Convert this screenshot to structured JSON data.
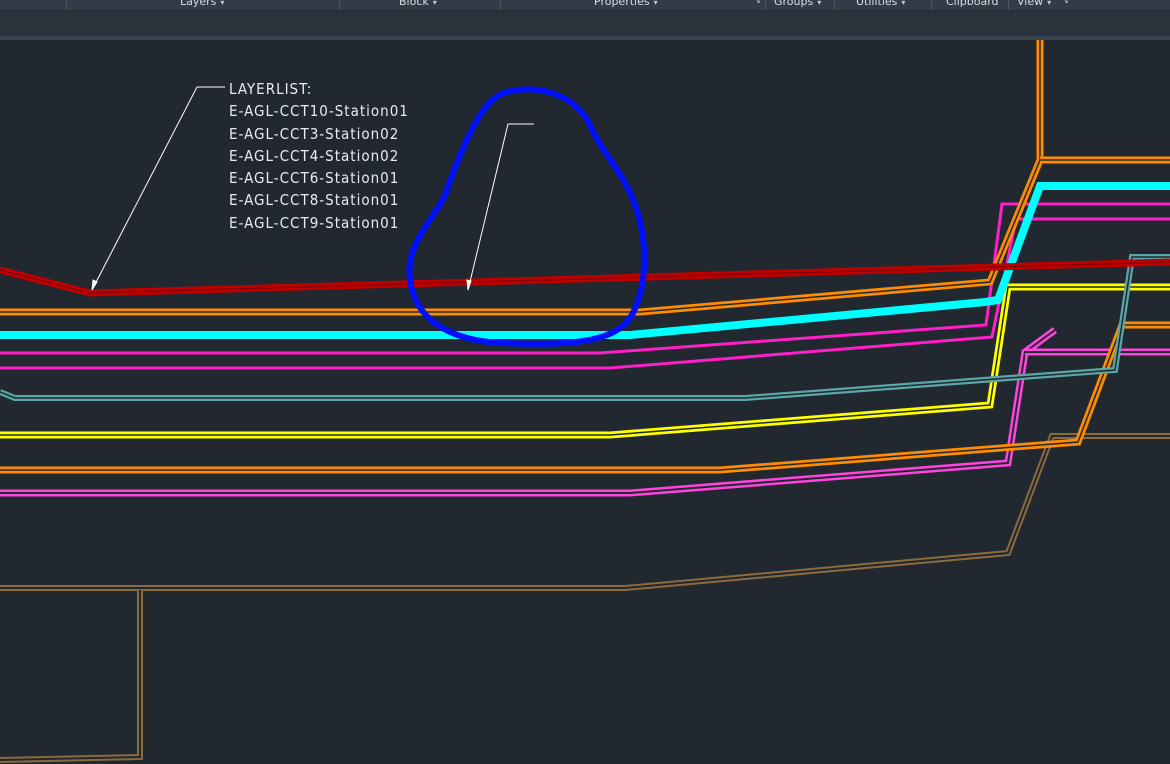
{
  "ribbon": {
    "panels": [
      {
        "label": "Layers",
        "has_caret": true,
        "has_launcher": false
      },
      {
        "label": "Block",
        "has_caret": true,
        "has_launcher": false
      },
      {
        "label": "Properties",
        "has_caret": true,
        "has_launcher": true
      },
      {
        "label": "Groups",
        "has_caret": true,
        "has_launcher": false
      },
      {
        "label": "Utilities",
        "has_caret": true,
        "has_launcher": false
      },
      {
        "label": "Clipboard",
        "has_caret": false,
        "has_launcher": false
      },
      {
        "label": "View",
        "has_caret": true,
        "has_launcher": true
      }
    ],
    "caret_glyph": "▾",
    "launcher_glyph": "↘"
  },
  "drawing": {
    "background": "#212830",
    "annotation": {
      "header": "LAYERLIST:",
      "layers": [
        "E-AGL-CCT10-Station01",
        "E-AGL-CCT3-Station02",
        "E-AGL-CCT4-Station02",
        "E-AGL-CCT6-Station01",
        "E-AGL-CCT8-Station01",
        "E-AGL-CCT9-Station01"
      ]
    },
    "line_colors": {
      "red": "#c00000",
      "orange": "#ff8c00",
      "cyan": "#00ffff",
      "magenta": "#ff1fc8",
      "teal": "#5aa7a7",
      "yellow": "#ffff00",
      "pink": "#ff44dd",
      "brown": "#8b6a3e",
      "markup_blue": "#0010ff",
      "leader_white": "#ffffff"
    }
  }
}
